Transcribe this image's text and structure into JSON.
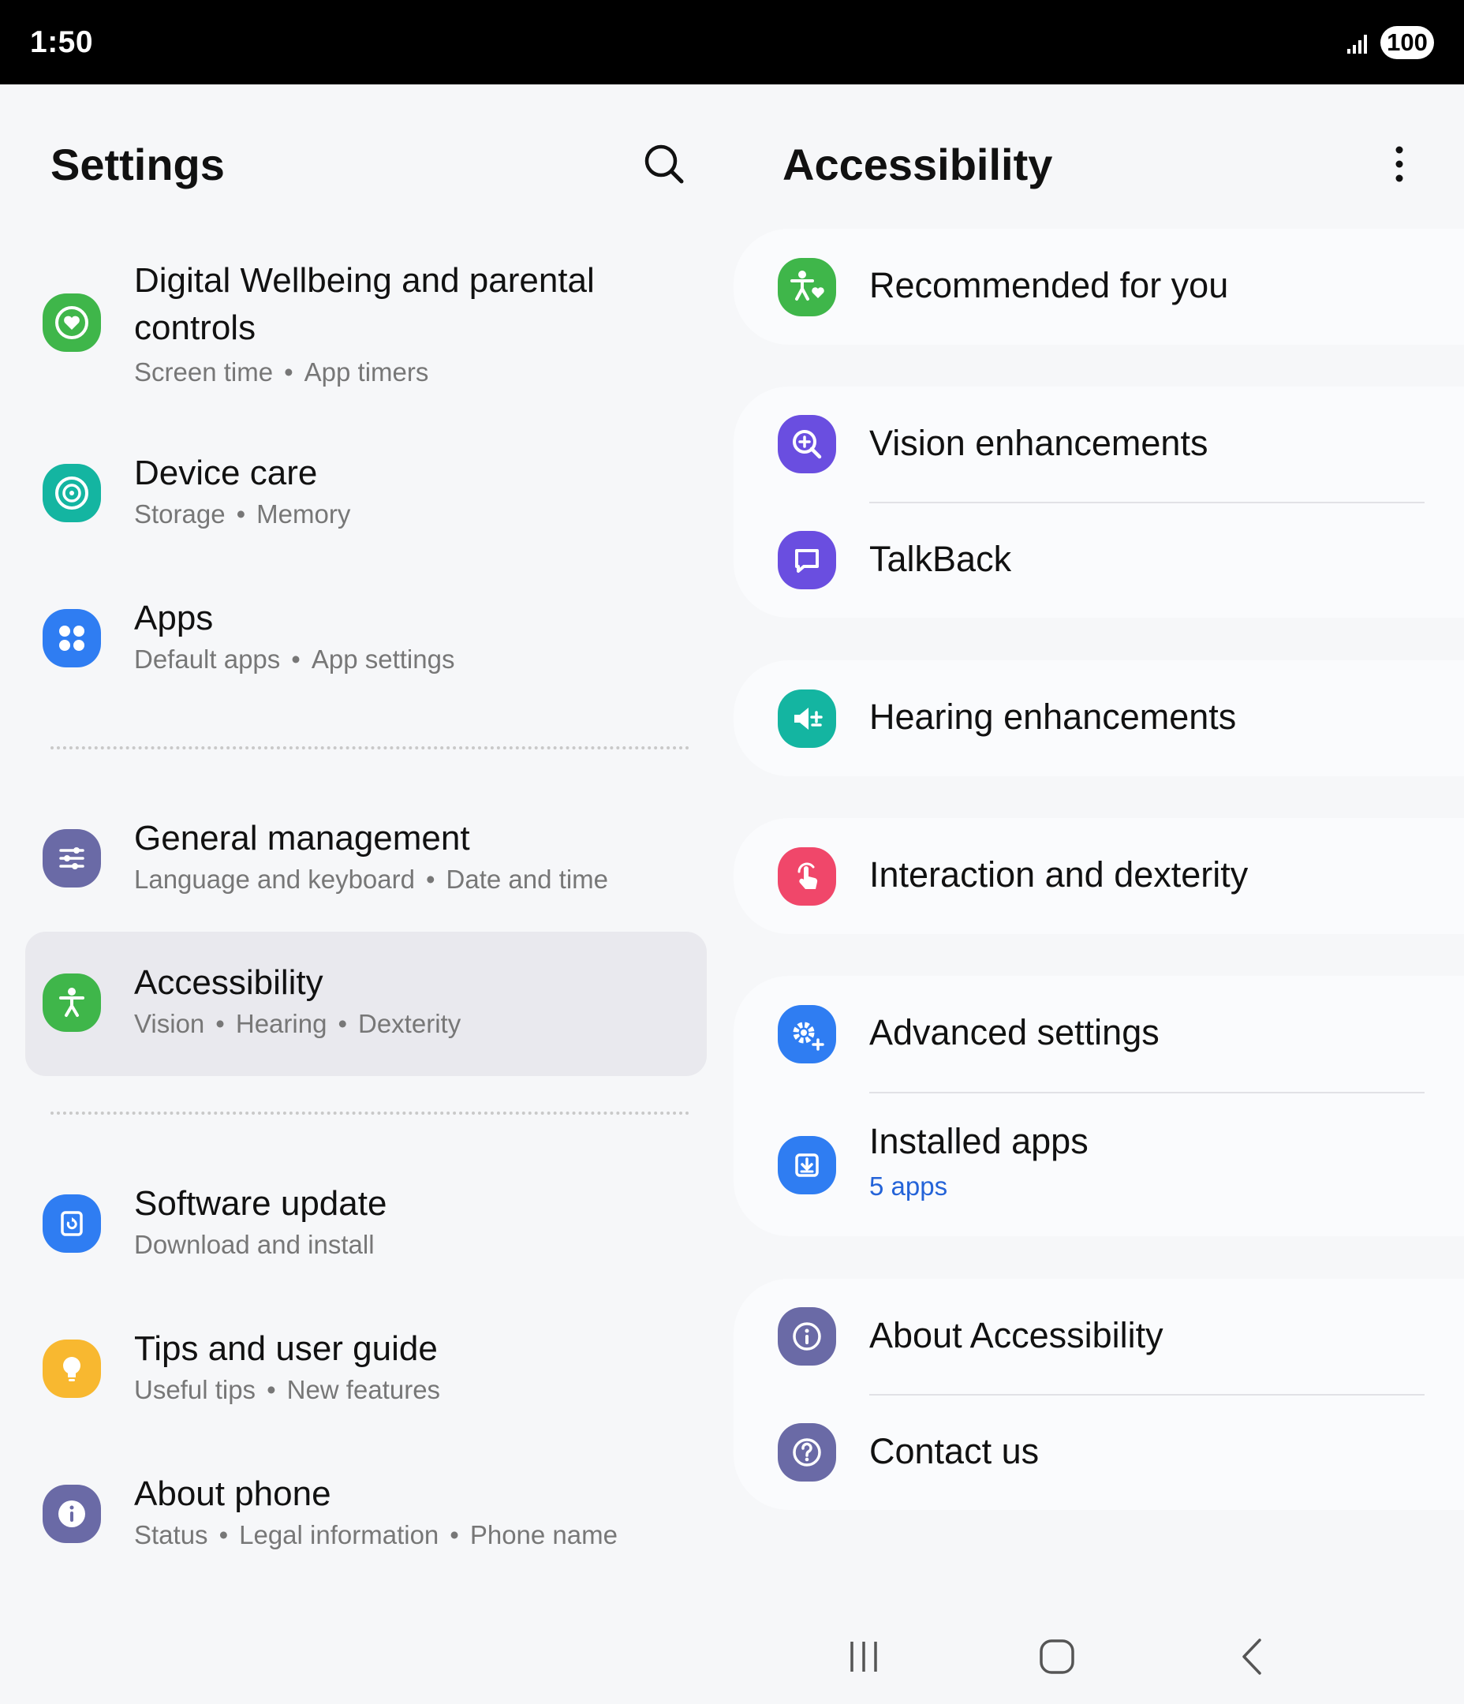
{
  "status_bar": {
    "time": "1:50",
    "battery": "100"
  },
  "left": {
    "title": "Settings",
    "items": [
      {
        "title": "Digital Wellbeing and parental controls",
        "sub": [
          "Screen time",
          "App timers"
        ],
        "icon": "wellbeing-icon",
        "color": "#3fb64a"
      },
      {
        "title": "Device care",
        "sub": [
          "Storage",
          "Memory"
        ],
        "icon": "device-care-icon",
        "color": "#14b5a1"
      },
      {
        "title": "Apps",
        "sub": [
          "Default apps",
          "App settings"
        ],
        "icon": "apps-icon",
        "color": "#2f7df2"
      },
      {
        "title": "General management",
        "sub": [
          "Language and keyboard",
          "Date and time"
        ],
        "icon": "sliders-icon",
        "color": "#6a6aa6"
      },
      {
        "title": "Accessibility",
        "sub": [
          "Vision",
          "Hearing",
          "Dexterity"
        ],
        "icon": "accessibility-icon",
        "color": "#3fb64a"
      },
      {
        "title": "Software update",
        "sub": [
          "Download and install"
        ],
        "icon": "software-update-icon",
        "color": "#2f7df2"
      },
      {
        "title": "Tips and user guide",
        "sub": [
          "Useful tips",
          "New features"
        ],
        "icon": "lightbulb-icon",
        "color": "#f8b830"
      },
      {
        "title": "About phone",
        "sub": [
          "Status",
          "Legal information",
          "Phone name"
        ],
        "icon": "info-icon",
        "color": "#6a6aa6"
      }
    ]
  },
  "right": {
    "title": "Accessibility",
    "rows": {
      "recommended": "Recommended for you",
      "vision": "Vision enhancements",
      "talkback": "TalkBack",
      "hearing": "Hearing enhancements",
      "interaction": "Interaction and dexterity",
      "advanced": "Advanced settings",
      "installed": "Installed apps",
      "installed_sub": "5 apps",
      "about": "About Accessibility",
      "contact": "Contact us"
    }
  },
  "colors": {
    "green": "#3fb64a",
    "purple": "#6a4ee0",
    "teal": "#14b5a1",
    "pink": "#f0476a",
    "blue": "#2f7df2",
    "slate": "#6a6aa6",
    "link": "#2463d8"
  }
}
